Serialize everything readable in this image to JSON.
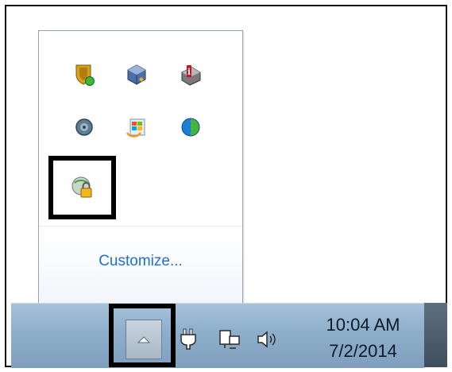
{
  "flyout": {
    "customize_label": "Customize...",
    "icons": [
      {
        "name": "security-shield-icon"
      },
      {
        "name": "virtualbox-icon"
      },
      {
        "name": "info-toolbox-icon"
      },
      {
        "name": "disc-gear-icon"
      },
      {
        "name": "windows-update-icon"
      },
      {
        "name": "globe-icon"
      },
      {
        "name": "vpn-lock-icon"
      }
    ]
  },
  "taskbar": {
    "time": "10:04 AM",
    "date": "7/2/2014",
    "icons": [
      "show-hidden-icons-button",
      "power-plug-icon",
      "network-icon",
      "volume-icon"
    ]
  },
  "colors": {
    "link": "#1e6fcf",
    "highlight": "#000000",
    "taskbar": "#8fb0cd"
  }
}
